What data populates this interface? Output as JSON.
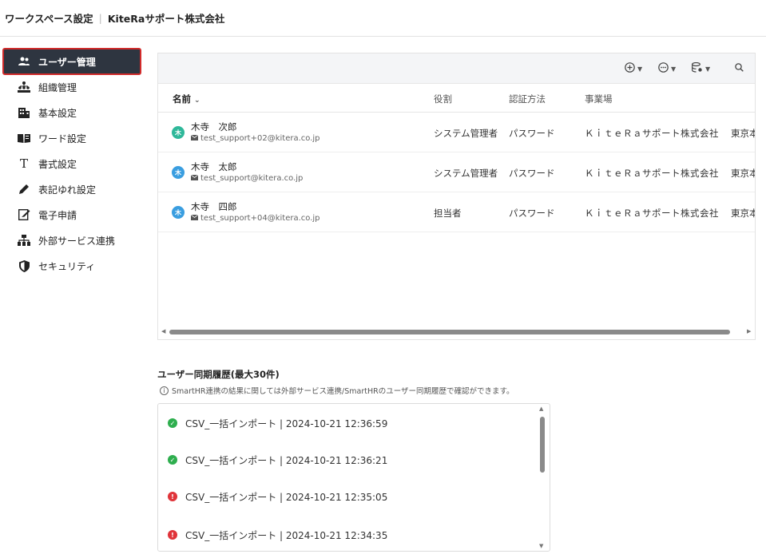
{
  "header": {
    "title": "ワークスペース設定",
    "company": "KiteRaサポート株式会社"
  },
  "sidebar": {
    "items": [
      {
        "label": "ユーザー管理",
        "icon": "users-icon",
        "active": true
      },
      {
        "label": "組織管理",
        "icon": "org-chart-icon"
      },
      {
        "label": "基本設定",
        "icon": "building-icon"
      },
      {
        "label": "ワード設定",
        "icon": "book-icon"
      },
      {
        "label": "書式設定",
        "icon": "text-format-icon"
      },
      {
        "label": "表記ゆれ設定",
        "icon": "pencil-icon"
      },
      {
        "label": "電子申請",
        "icon": "e-application-icon"
      },
      {
        "label": "外部サービス連携",
        "icon": "sitemap-icon"
      },
      {
        "label": "セキュリティ",
        "icon": "shield-icon"
      }
    ]
  },
  "table": {
    "columns": {
      "name": "名前",
      "role": "役割",
      "auth": "認証方法",
      "office": "事業場"
    },
    "rows": [
      {
        "avatar": "木",
        "avatar_color": "#2fb89a",
        "name": "木寺　次郎",
        "email": "test_support+02@kitera.co.jp",
        "role": "システム管理者",
        "auth": "パスワード",
        "office": "ＫｉｔｅＲａサポート株式会社",
        "extra": "東京本"
      },
      {
        "avatar": "木",
        "avatar_color": "#3a9ee0",
        "name": "木寺　太郎",
        "email": "test_support@kitera.co.jp",
        "role": "システム管理者",
        "auth": "パスワード",
        "office": "ＫｉｔｅＲａサポート株式会社",
        "extra": "東京本"
      },
      {
        "avatar": "木",
        "avatar_color": "#3a9ee0",
        "name": "木寺　四郎",
        "email": "test_support+04@kitera.co.jp",
        "role": "担当者",
        "auth": "パスワード",
        "office": "ＫｉｔｅＲａサポート株式会社",
        "extra": "東京本"
      }
    ]
  },
  "history": {
    "title": "ユーザー同期履歴(最大30件)",
    "note": "SmartHR連携の結果に関しては外部サービス連携/SmartHRのユーザー同期履歴で確認ができます。",
    "items": [
      {
        "label": "CSV_一括インポート | 2024-10-21 12:36:59",
        "status": "success"
      },
      {
        "label": "CSV_一括インポート | 2024-10-21 12:36:21",
        "status": "success"
      },
      {
        "label": "CSV_一括インポート | 2024-10-21 12:35:05",
        "status": "error"
      },
      {
        "label": "CSV_一括インポート | 2024-10-21 12:34:35",
        "status": "error"
      }
    ]
  },
  "colors": {
    "success": "#2eae4e",
    "error": "#e0343a",
    "active_nav_bg": "#2e3540",
    "active_nav_outline": "#d12b2b"
  }
}
